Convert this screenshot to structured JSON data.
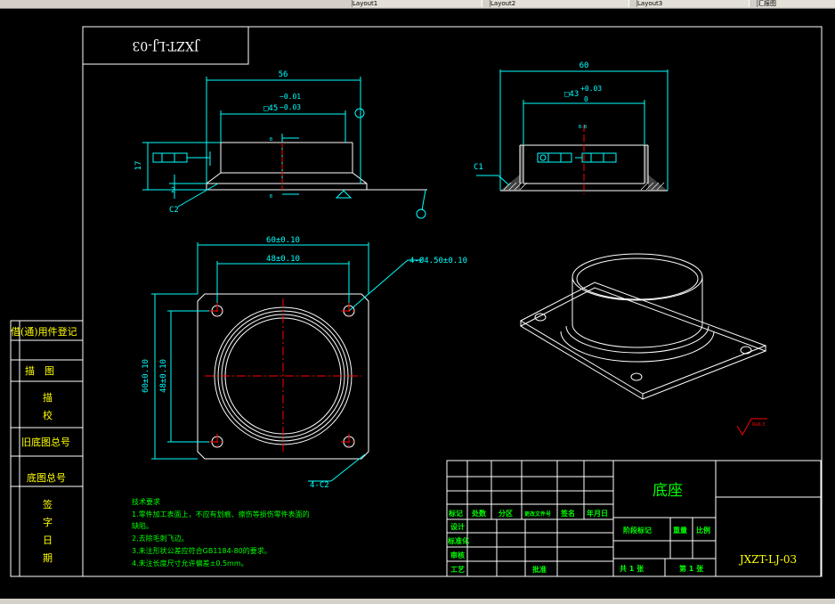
{
  "toolbar": {
    "tabs": [
      "Layout1",
      "Layout2",
      "Layout3",
      "汇报图"
    ]
  },
  "drawing": {
    "number": "JXZT-LJ-03",
    "part_name": "底座",
    "front_view": {
      "dim_width": "56",
      "dim_inner": "□45",
      "tol_inner_upper": "−0.01",
      "tol_inner_lower": "−0.03",
      "dim_height": "17",
      "dim_base": "2",
      "chamfer": "C2",
      "section_label": "B"
    },
    "side_view": {
      "dim_width": "60",
      "dim_inner": "□43",
      "tol_upper": "+0.03",
      "tol_lower": "0",
      "chamfer": "C1",
      "section_label": "B-B"
    },
    "top_view": {
      "dim_outer_x": "60±0.10",
      "dim_holes_x": "48±0.10",
      "dim_outer_y": "60±0.10",
      "dim_holes_y": "48±0.10",
      "hole_callout": "4-Ø4.50±0.10",
      "corner_chamfer": "4-C2"
    },
    "roughness": "Ra6.3",
    "tech_req": {
      "title": "技术要求",
      "items": [
        "1.零件加工表面上，不应有划痕、擦伤等损伤零件表面的",
        "缺陷。",
        "2.去除毛刺飞边。",
        "3.未注形状公差应符合GB1184-80的要求。",
        "4.未注长度尺寸允许偏差±0.5mm。"
      ]
    },
    "left_column": [
      "借(通)用件登记",
      "描　图",
      "描",
      "校",
      "旧底图总号",
      "底图总号",
      "签",
      "字",
      "日",
      "期"
    ],
    "title_block": {
      "row_labels": [
        "标记",
        "处数",
        "分区",
        "更改文件号",
        "签名",
        "年月日"
      ],
      "roles": [
        "设计",
        "标准化",
        "审核",
        "工艺"
      ],
      "approve": "批准",
      "stage": "阶段标记",
      "weight": "重量",
      "scale": "比例",
      "sheets_total": "共 1 张",
      "sheet_no": "第 1 张"
    }
  },
  "colors": {
    "background": "#000000",
    "border": "#ffffff",
    "dimension": "#00ffff",
    "centerline": "#ff0000",
    "text": "#00ff00",
    "title": "#ffff00"
  }
}
